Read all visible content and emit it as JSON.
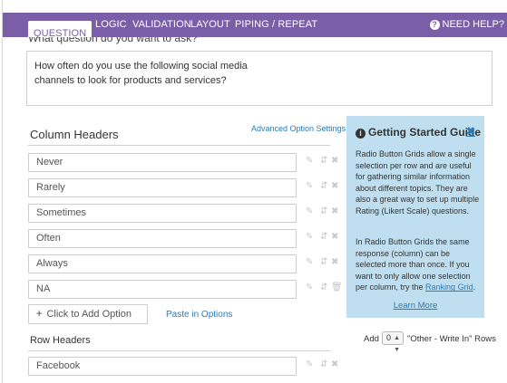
{
  "tabs": [
    {
      "label": "QUESTION",
      "active": true
    },
    {
      "label": "LOGIC",
      "active": false
    },
    {
      "label": "VALIDATION",
      "active": false
    },
    {
      "label": "LAYOUT",
      "active": false
    },
    {
      "label": "PIPING / REPEAT",
      "active": false
    }
  ],
  "help": {
    "icon": "question-circle-icon",
    "label": "NEED HELP?"
  },
  "clipped": {
    "heading": "What question do you want to ask?"
  },
  "question": {
    "text": "How often do you use the following social media channels to look for products and services?"
  },
  "columns": {
    "title": "Column Headers",
    "advanced_link": "Advanced Option Settings",
    "options": [
      "Never",
      "Rarely",
      "Sometimes",
      "Often",
      "Always",
      "NA"
    ],
    "add_placeholder": "Click to Add Option",
    "paste_link": "Paste in Options"
  },
  "rows": {
    "title": "Row Headers",
    "options": [
      "Facebook"
    ]
  },
  "guide": {
    "title": "Getting Started Guide",
    "close": "✖",
    "p1": "Radio Button Grids allow a single selection per row and are useful for gathering similar information about different topics. They are also a great way to set up multiple Rating (Likert Scale) questions.",
    "p2_pre": "In Radio Button Grids the same response (column) can be selected more than once. If you want to only allow one selection per column, try the ",
    "p2_link": "Ranking Grid",
    "p2_post": ".",
    "learn_more": "Learn More"
  },
  "write_in": {
    "prefix": "Add",
    "count": "0",
    "suffix": "\"Other - Write In\" Rows"
  },
  "colors": {
    "tab_bar": "#7a5ea7",
    "link": "#2b7bb9",
    "guide_bg": "#bfdff0"
  }
}
